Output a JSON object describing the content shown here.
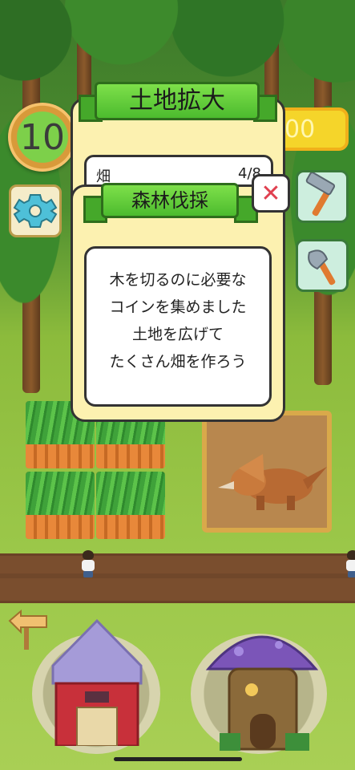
{
  "hud": {
    "level": "10",
    "coins": "00"
  },
  "dialog_back": {
    "title": "土地拡大",
    "row_name": "畑",
    "row_count": "4/8"
  },
  "dialog_front": {
    "title": "森林伐採",
    "lines": [
      "木を切るのに必要な",
      "コインを集めました",
      "土地を広げて",
      "たくさん畑を作ろう"
    ],
    "close_glyph": "✕"
  },
  "icons": {
    "settings": "gear-icon",
    "build": "hammer-icon",
    "chop": "axe-icon",
    "back": "arrow-sign-icon"
  },
  "colors": {
    "ribbon_green": "#5cc83a",
    "panel_yellow": "#fcf1b0",
    "coin_yellow": "#f5d52a",
    "close_red": "#e04050"
  }
}
